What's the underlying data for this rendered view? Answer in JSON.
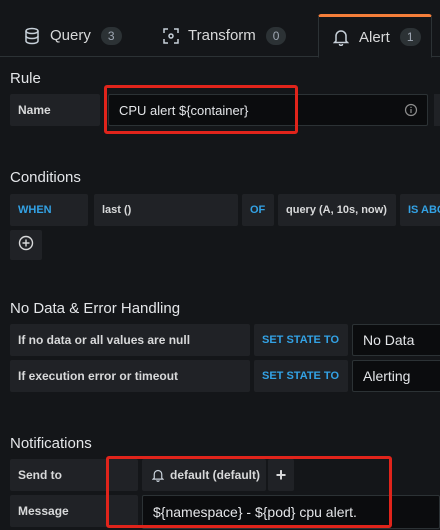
{
  "tabs": [
    {
      "label": "Query",
      "count": "3",
      "icon": "database-icon"
    },
    {
      "label": "Transform",
      "count": "0",
      "icon": "transform-icon"
    },
    {
      "label": "Alert",
      "count": "1",
      "icon": "bell-icon"
    }
  ],
  "rule": {
    "heading": "Rule",
    "name_label": "Name",
    "name_value": "CPU alert ${container}",
    "info_icon": "info-icon"
  },
  "conditions": {
    "heading": "Conditions",
    "when": "WHEN",
    "reducer": "last ()",
    "of": "OF",
    "query": "query (A, 10s, now)",
    "evaluator": "IS ABO",
    "add_icon": "plus-circle-icon"
  },
  "nodata": {
    "heading": "No Data & Error Handling",
    "row1_label": "If no data or all values are null",
    "row1_action": "SET STATE TO",
    "row1_value": "No Data",
    "row2_label": "If execution error or timeout",
    "row2_action": "SET STATE TO",
    "row2_value": "Alerting"
  },
  "notifications": {
    "heading": "Notifications",
    "send_label": "Send to",
    "channel": "default (default)",
    "add_symbol": "+",
    "message_label": "Message",
    "message_value": "${namespace} - ${pod} cpu alert."
  },
  "colors": {
    "accent_orange": "#f57e3a",
    "highlight_red": "#e0241b",
    "keyword_blue": "#33a2e5",
    "background": "#141619"
  }
}
